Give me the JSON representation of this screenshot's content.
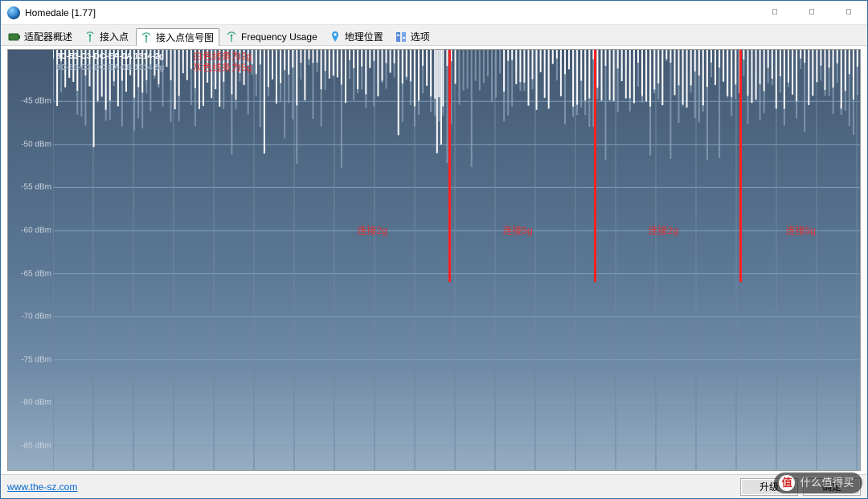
{
  "window": {
    "title": "Homedale [1.77]"
  },
  "tabs": [
    {
      "label": "适配器概述"
    },
    {
      "label": "接入点"
    },
    {
      "label": "接入点信号图",
      "active": true
    },
    {
      "label": "Frequency Usage"
    },
    {
      "label": "地理位置"
    },
    {
      "label": "选项"
    }
  ],
  "legend": {
    "line1": "8C-53-C3-DC-EA-0A 1314-2g",
    "line2": "8C-53-C3-DC-EA-0B 1314-5g"
  },
  "annotations": {
    "legend1_note": "白色线条为2g",
    "legend2_note": "灰色线条为5g",
    "region1": "连接2g",
    "region2": "连接5g",
    "region3": "连接2g",
    "region4": "连接5g"
  },
  "footer": {
    "url": "www.the-sz.com",
    "btn_left": "升级",
    "btn_right": "确定"
  },
  "watermark": "什么值得买",
  "chart_data": {
    "type": "line",
    "ylabel": "dBm",
    "ylim": [
      -88,
      -39
    ],
    "yticks": [
      -45,
      -50,
      -55,
      -60,
      -65,
      -70,
      -75,
      -80,
      -85
    ],
    "ytick_labels": [
      "-45 dBm",
      "-50 dBm",
      "-55 dBm",
      "-60 dBm",
      "-65 dBm",
      "-70 dBm",
      "-75 dBm",
      "-80 dBm",
      "-85 dBm"
    ],
    "x_samples": 200,
    "series": [
      {
        "name": "8C-53-C3-DC-EA-0A 1314-2g",
        "color": "#ffffff",
        "approx_range_dbm": [
          -39,
          -47
        ],
        "note": "mostly ~‑40..‑45, short dips to ~‑50 near first marker and ~‑45..‑50 in middle"
      },
      {
        "name": "8C-53-C3-DC-EA-0B 1314-5g",
        "color": "#8ea3b8",
        "approx_range_dbm": [
          -39,
          -50
        ],
        "note": "mostly ~‑40..‑48, occasional dips to ‑50"
      }
    ],
    "markers_x_fraction": [
      0.49,
      0.67,
      0.85
    ],
    "region_labels_x_fraction": [
      0.4,
      0.58,
      0.76,
      0.93
    ]
  }
}
